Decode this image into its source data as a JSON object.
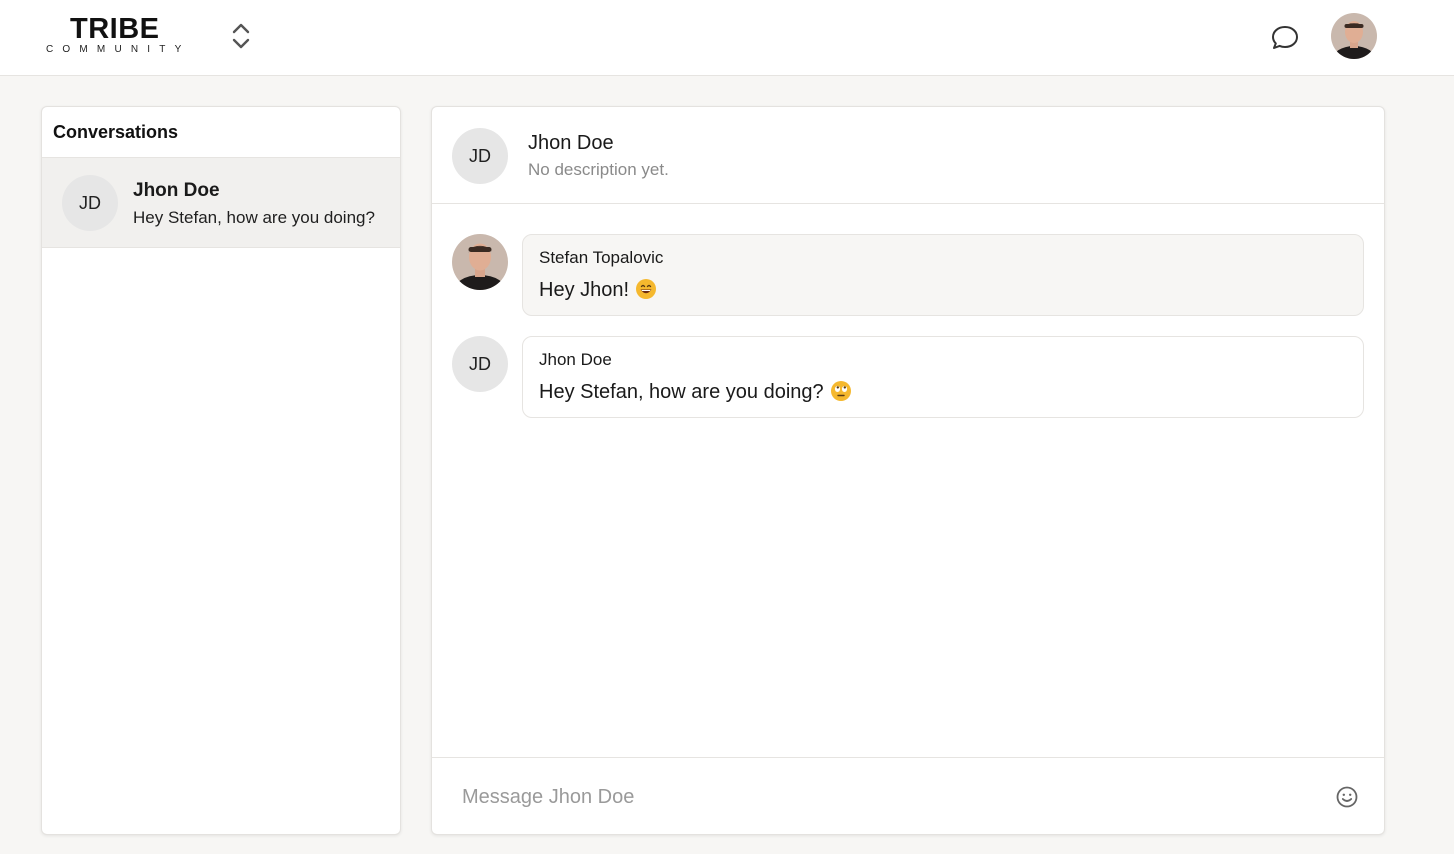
{
  "header": {
    "logo_main": "TRIBE",
    "logo_sub": "COMMUNITY",
    "switcher_icon": "chevron-up-down-icon",
    "chat_icon": "chat-bubble-icon",
    "user_avatar": "user-photo-avatar"
  },
  "sidebar": {
    "title": "Conversations",
    "conversations": [
      {
        "initials": "JD",
        "name": "Jhon Doe",
        "preview": "Hey Stefan, how are you doing?",
        "selected": true
      }
    ]
  },
  "chat": {
    "header": {
      "initials": "JD",
      "name": "Jhon Doe",
      "description": "No description yet."
    },
    "messages": [
      {
        "author": "Stefan Topalovic",
        "text": "Hey Jhon!",
        "emoji": "grinning-face-icon",
        "avatar": "photo"
      },
      {
        "author": "Jhon Doe",
        "initials": "JD",
        "text": "Hey Stefan, how are you doing?",
        "emoji": "rolling-eyes-face-icon",
        "avatar": "initials"
      }
    ],
    "composer": {
      "placeholder": "Message Jhon Doe",
      "value": "",
      "emoji_icon": "smiley-icon"
    }
  },
  "colors": {
    "background": "#f7f6f4",
    "panel": "#ffffff",
    "border": "#e6e4e1",
    "selected_item": "#f1f0ee",
    "avatar_bg": "#e6e6e6",
    "muted_text": "#8a8a8a",
    "emoji_yellow": "#f5b82e"
  }
}
